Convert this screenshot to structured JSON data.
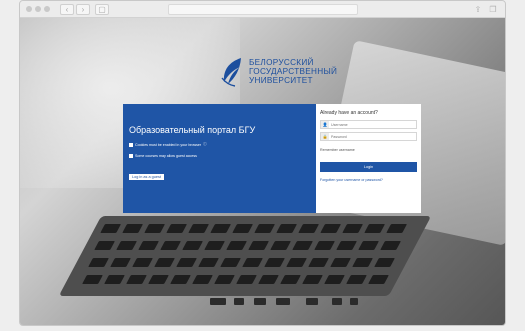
{
  "browser": {
    "url": "",
    "nav_back": "‹",
    "nav_forward": "›",
    "sidebar_icon": "▢",
    "share_icon": "⇪",
    "tabs_icon": "❐"
  },
  "brand": {
    "line1": "БЕЛОРУССКИЙ",
    "line2": "ГОСУДАРСТВЕННЫЙ",
    "line3": "УНИВЕРСИТЕТ",
    "color": "#1d4f9e"
  },
  "left_panel": {
    "title": "Образовательный портал БГУ",
    "cookies_notice": "Cookies must be enabled in your browser",
    "guest_notice": "Some courses may allow guest access",
    "guest_button": "Log in as a guest",
    "bg_color": "#1f55a6"
  },
  "right_panel": {
    "heading": "Already have an account?",
    "username_placeholder": "Username",
    "password_placeholder": "Password",
    "remember_label": "Remember username",
    "login_button": "Login",
    "forgot_link": "Forgotten your username or password?"
  }
}
